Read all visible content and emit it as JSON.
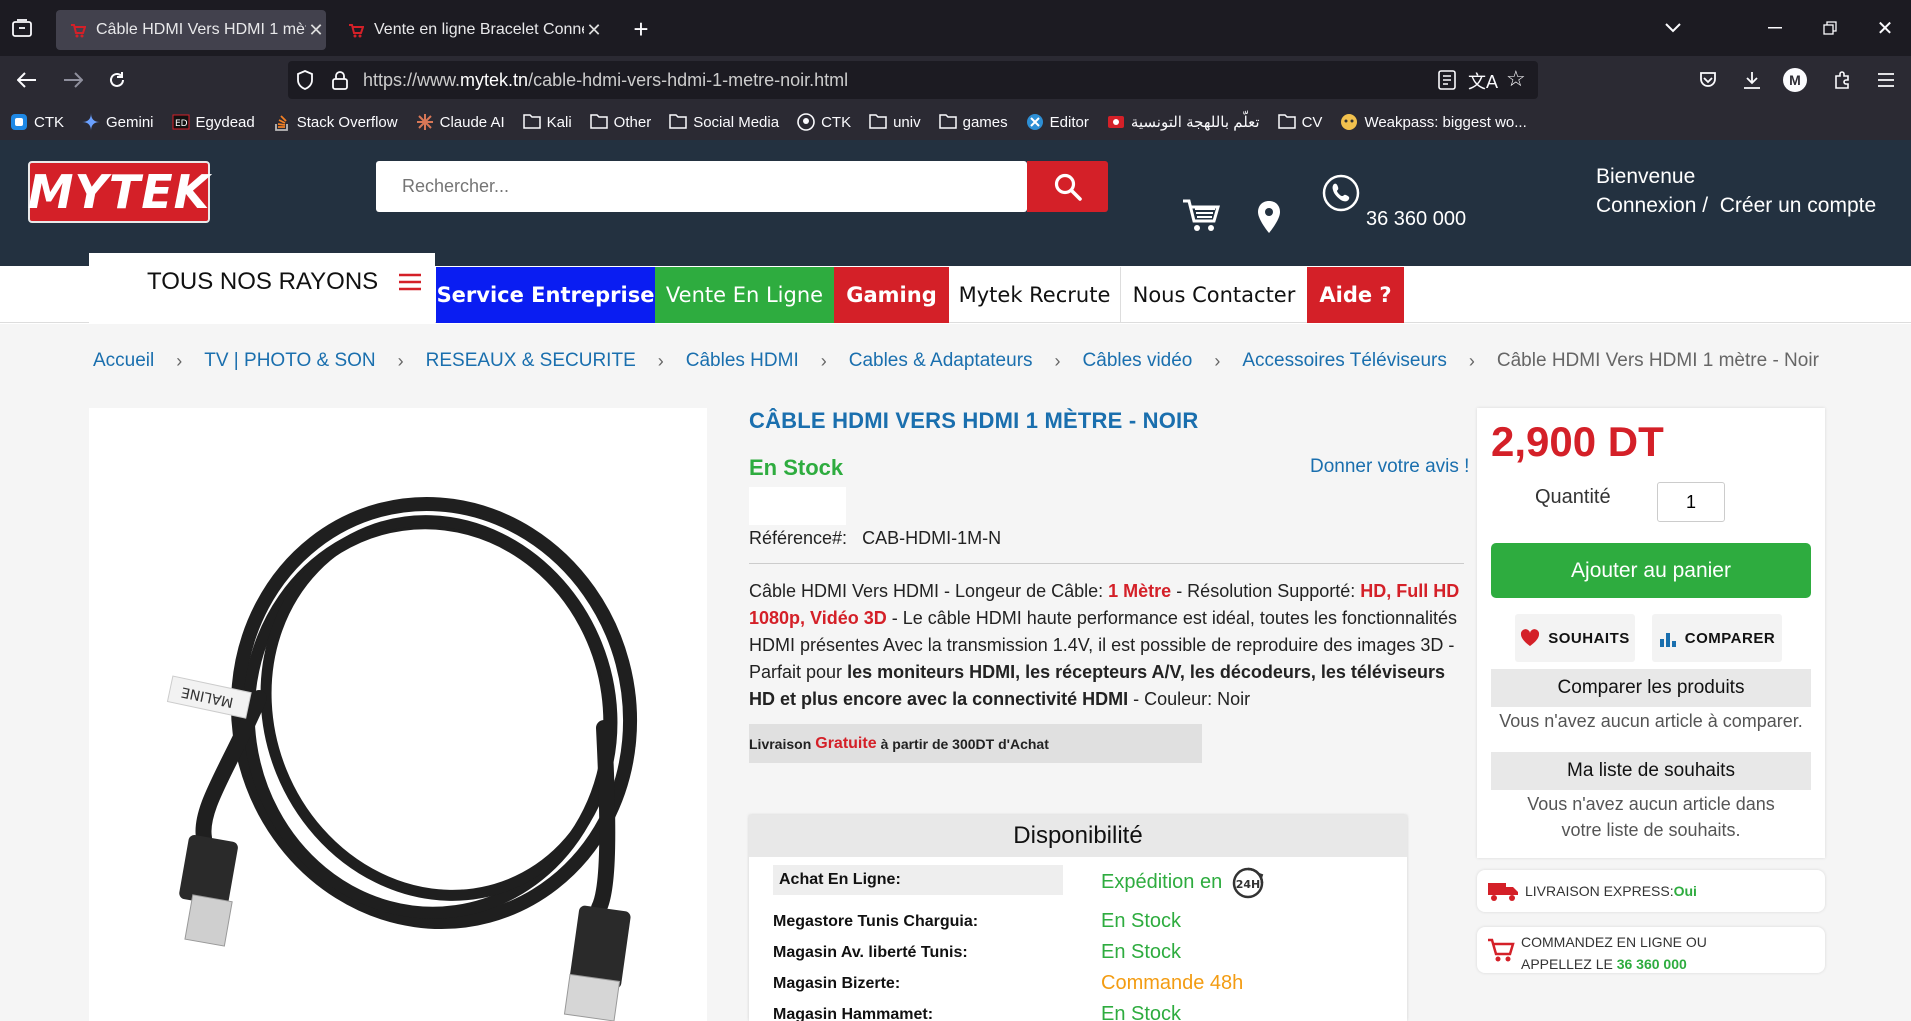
{
  "browser": {
    "tabs": [
      {
        "title": "Câble HDMI Vers HDMI 1 mètre",
        "active": true
      },
      {
        "title": "Vente en ligne Bracelet Connec",
        "active": false
      }
    ],
    "url_prefix": "https://www.",
    "url_domain": "mytek.tn",
    "url_path": "/cable-hdmi-vers-hdmi-1-metre-noir.html",
    "bookmarks": [
      "CTK",
      "Gemini",
      "Egydead",
      "Stack Overflow",
      "Claude AI",
      "Kali",
      "Other",
      "Social Media",
      "CTK",
      "univ",
      "games",
      "Editor",
      "تعلّم باللهجة التونسية",
      "CV",
      "Weakpass: biggest wo..."
    ],
    "profile_initial": "M"
  },
  "header": {
    "logo_text": "MYTEK",
    "search_placeholder": "Rechercher...",
    "phone": "36 360 000",
    "welcome": "Bienvenue",
    "login": "Connexion /",
    "register": "Créer un compte"
  },
  "menu": {
    "rayons": "TOUS NOS RAYONS",
    "items": [
      "Service Entreprise",
      "Vente En Ligne",
      "Gaming",
      "Mytek Recrute",
      "Nous Contacter",
      "Aide ?"
    ],
    "colors": {
      "service": "#0a1df2",
      "vente": "#2eac3f",
      "gaming": "#d42028",
      "aide": "#d42028"
    }
  },
  "breadcrumbs": [
    "Accueil",
    "TV | PHOTO & SON",
    "RESEAUX & SECURITE",
    "Câbles HDMI",
    "Cables & Adaptateurs",
    "Câbles vidéo",
    "Accessoires Téléviseurs"
  ],
  "breadcrumb_current": "Câble HDMI Vers HDMI 1 mètre - Noir",
  "product": {
    "title": "CÂBLE HDMI VERS HDMI 1 MÈTRE - NOIR",
    "stock": "En Stock",
    "review_link": "Donner votre avis !",
    "reference_label": "Référence#:",
    "reference": "CAB-HDMI-1M-N",
    "desc": {
      "p1": "Câble HDMI Vers HDMI - Longeur de Câble: ",
      "r1": "1 Mètre",
      "p2": " - Résolution Supporté: ",
      "r2": "HD, Full HD 1080p, Vidéo 3D",
      "p3": " - Le câble HDMI haute performance est idéal, toutes les fonctionnalités HDMI présentes Avec la transmission 1.4V, il est possible de reproduire des images 3D - Parfait pour ",
      "b1": "les moniteurs HDMI, les récepteurs A/V, les décodeurs, les téléviseurs HD et plus encore avec la connectivité HDMI",
      "p4": " - Couleur: Noir"
    },
    "shipping_pre": "Livraison",
    "shipping_free": "Gratuite",
    "shipping_post": "à partir de 300DT d'Achat"
  },
  "availability": {
    "heading": "Disponibilité",
    "rows": [
      {
        "store": "Achat En Ligne:",
        "status": "Expédition en",
        "color": "#2eac3f"
      },
      {
        "store": "Megastore Tunis Charguia:",
        "status": "En Stock",
        "color": "#2eac3f"
      },
      {
        "store": "Magasin Av. liberté Tunis:",
        "status": "En Stock",
        "color": "#2eac3f"
      },
      {
        "store": "Magasin Bizerte:",
        "status": "Commande 48h",
        "color": "#f39c12"
      },
      {
        "store": "Magasin Hammamet:",
        "status": "En Stock",
        "color": "#2eac3f"
      }
    ],
    "badge_24h": "24H"
  },
  "buy": {
    "price": "2,900 DT",
    "qty_label": "Quantité",
    "qty_value": "1",
    "add_to_cart": "Ajouter au panier",
    "wishlist": "SOUHAITS",
    "compare": "COMPARER",
    "compare_head": "Comparer les produits",
    "compare_text": "Vous n'avez aucun article à comparer.",
    "wishlist_head": "Ma liste de souhaits",
    "wishlist_text": "Vous n'avez aucun article dans votre liste de souhaits."
  },
  "express": {
    "label": "LIVRAISON EXPRESS: ",
    "value": "Oui"
  },
  "order_phone": {
    "line1": "COMMANDEZ EN LIGNE OU",
    "line2": "APPELLEZ LE ",
    "phone": "36 360 000"
  },
  "product_image_label": "MALINE"
}
